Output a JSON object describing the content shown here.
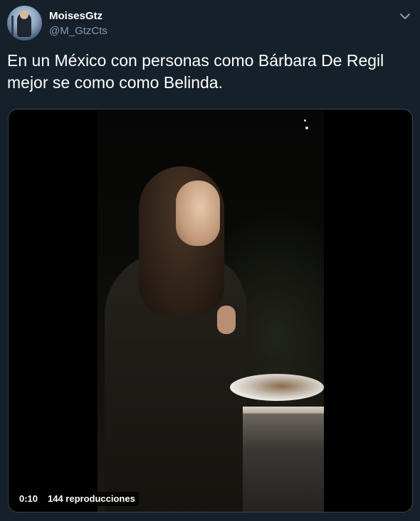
{
  "author": {
    "name": "MoisesGtz",
    "handle": "@M_GtzCts",
    "avatar_icon": "user-avatar"
  },
  "menu_icon": "chevron-down-icon",
  "tweet": {
    "text": "En un México con personas como Bárbara De Regil mejor se como como Belinda."
  },
  "video": {
    "duration": "0:10",
    "views": "144 reproducciones"
  },
  "colors": {
    "background": "#15202b",
    "secondary_text": "#8899a6",
    "border": "#38444d"
  }
}
